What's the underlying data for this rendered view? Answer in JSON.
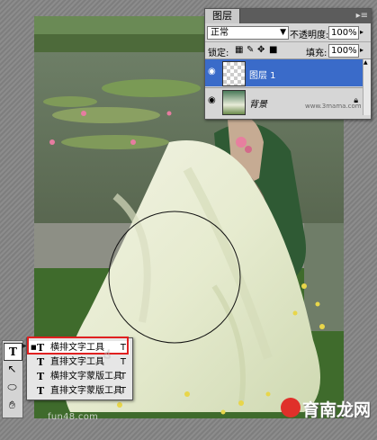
{
  "layers_panel": {
    "tab_title": "图层",
    "blend_mode": "正常",
    "opacity_label": "不透明度:",
    "opacity_value": "100%",
    "lock_label": "锁定:",
    "fill_label": "填充:",
    "fill_value": "100%",
    "layers": [
      {
        "name": "图层 1",
        "selected": true
      },
      {
        "name": "背景",
        "selected": false,
        "locked": true
      }
    ]
  },
  "tools": {
    "active": "T"
  },
  "flyout": {
    "items": [
      {
        "label": "横排文字工具",
        "shortcut": "T",
        "icon": "T",
        "checked": true
      },
      {
        "label": "直排文字工具",
        "shortcut": "T",
        "icon": "T",
        "checked": false
      },
      {
        "label": "横排文字蒙版工具",
        "shortcut": "T",
        "icon": "T",
        "checked": false
      },
      {
        "label": "直排文字蒙版工具",
        "shortcut": "T",
        "icon": "T",
        "checked": false
      }
    ]
  },
  "watermarks": {
    "left": "fun48.com",
    "panel": "www.3mama.com",
    "right": "育南龙网"
  },
  "colors": {
    "selection": "#3a6bc9",
    "highlight_box": "#e02020"
  }
}
